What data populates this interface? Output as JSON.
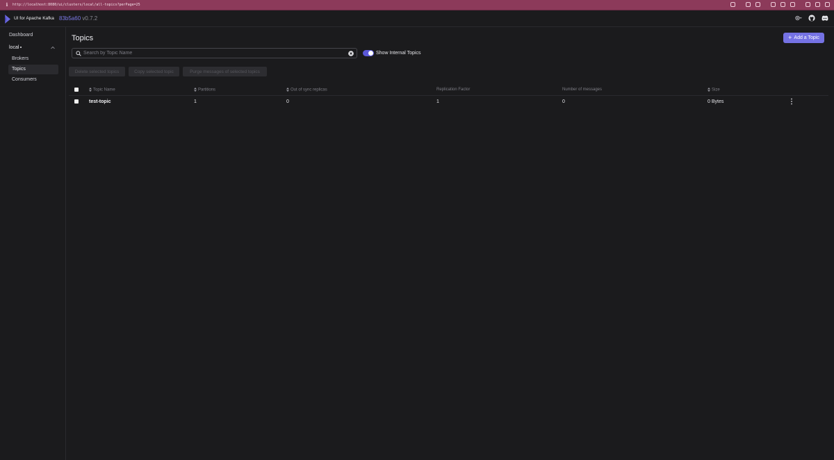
{
  "browser": {
    "url": "http://localhost:8080/ui/clusters/local/all-topics?perPage=25"
  },
  "header": {
    "brand": "UI for Apache Kafka",
    "version_hash": "83b5a60",
    "version": "v0.7.2"
  },
  "sidebar": {
    "dashboard": "Dashboard",
    "cluster": "local",
    "items": [
      {
        "label": "Brokers"
      },
      {
        "label": "Topics"
      },
      {
        "label": "Consumers"
      }
    ]
  },
  "main": {
    "title": "Topics",
    "add_button": "Add a Topic",
    "search_placeholder": "Search by Topic Name",
    "toggle_label": "Show Internal Topics",
    "toggle_on": true,
    "actions": {
      "delete": "Delete selected topics",
      "copy": "Copy selected topic",
      "purge": "Purge messages of selected topics"
    }
  },
  "table": {
    "columns": [
      "Topic Name",
      "Partitions",
      "Out of sync replicas",
      "Replication Factor",
      "Number of messages",
      "Size"
    ],
    "rows": [
      {
        "name": "test-topic",
        "partitions": "1",
        "out_of_sync": "0",
        "replication": "1",
        "messages": "0",
        "size": "0 Bytes"
      }
    ]
  },
  "colors": {
    "accent": "#7572e4",
    "browser_bar": "#8c3a5a",
    "background": "#1b1b1d"
  }
}
